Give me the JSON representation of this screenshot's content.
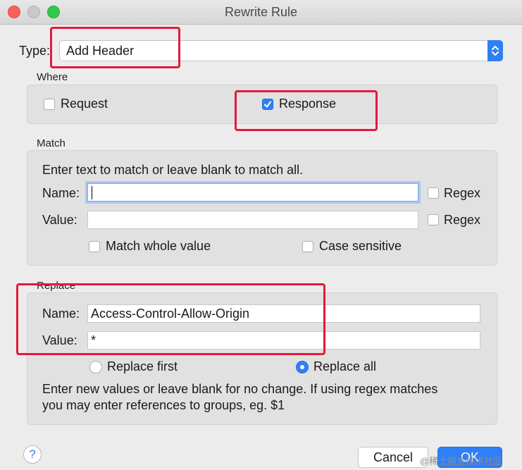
{
  "window": {
    "title": "Rewrite Rule"
  },
  "type": {
    "label": "Type:",
    "value": "Add Header"
  },
  "where": {
    "title": "Where",
    "request_label": "Request",
    "request_checked": false,
    "response_label": "Response",
    "response_checked": true
  },
  "match": {
    "title": "Match",
    "hint": "Enter text to match or leave blank to match all.",
    "name_label": "Name:",
    "name_value": "",
    "value_label": "Value:",
    "value_value": "",
    "regex_label": "Regex",
    "match_whole_label": "Match whole value",
    "case_sensitive_label": "Case sensitive"
  },
  "replace": {
    "title": "Replace",
    "name_label": "Name:",
    "name_value": "Access-Control-Allow-Origin",
    "value_label": "Value:",
    "value_value": "*",
    "replace_first_label": "Replace first",
    "replace_all_label": "Replace all",
    "selected": "Replace all",
    "hint_line1": "Enter new values or leave blank for no change. If using regex matches",
    "hint_line2": "you may enter references to groups, eg. $1"
  },
  "footer": {
    "help_symbol": "?",
    "cancel_label": "Cancel",
    "ok_label": "OK"
  },
  "watermark": "@稀土掘金技术社区",
  "colors": {
    "accent": "#2f7ff6",
    "annotation": "#e5193a"
  }
}
